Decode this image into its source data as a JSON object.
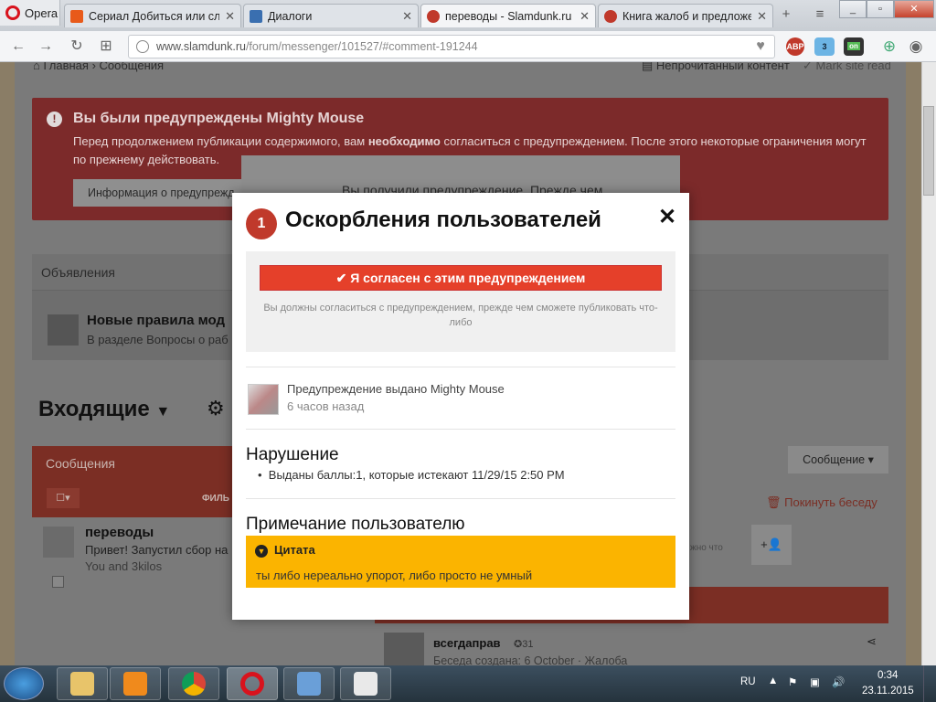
{
  "browser": {
    "opera_label": "Opera",
    "tabs": [
      {
        "title": "Сериал Добиться или сло",
        "active": false
      },
      {
        "title": "Диалоги",
        "active": false
      },
      {
        "title": "переводы - Slamdunk.ru -",
        "active": true
      },
      {
        "title": "Книга жалоб и предложе",
        "active": false
      }
    ],
    "url_host": "www.slamdunk.ru",
    "url_path": "/forum/messenger/101527/#comment-191244",
    "ext_abp": "ABP",
    "ext_ghost_count": "3",
    "ext_on": "on"
  },
  "page": {
    "breadcrumb_home": "Главная",
    "breadcrumb_current": "Сообщения",
    "unread_label": "Непрочитанный контент",
    "mark_read_label": "Mark site read",
    "alert_title": "Вы были предупреждены Mighty Mouse",
    "alert_text_1": "Перед продолжением публикации содержимого, вам ",
    "alert_text_bold": "необходимо",
    "alert_text_2": " согласиться с предупреждением. После этого некоторые ограничения могут",
    "alert_text_3": "по прежнему действовать.",
    "alert_button": "Информация о предупрежд",
    "announcements": "Объявления",
    "announce_title": "Новые правила мод",
    "announce_sub": "В разделе Вопросы о раб",
    "inbox_title": "Входящие",
    "messages_label": "Сообщения",
    "filter_label": "ФИЛЬ",
    "message_button": "Сообщение",
    "leave_conv": "Покинуть беседу",
    "conv_title": "переводы",
    "conv_preview": "Привет! Запустил сбор на",
    "conv_people": "You and 3kilos",
    "side_fragment": "жно что",
    "user_name": "всегдаправ",
    "user_rep": "31",
    "conv_created": "Беседа создана: 6 October · Жалоба",
    "back_card_text": "Вы получили предупреждение. Прежде чем"
  },
  "modal": {
    "badge": "1",
    "title": "Оскорбления пользователей",
    "close": "✕",
    "agree_button": "Я согласен с этим предупреждением",
    "agree_note": "Вы должны согласиться с предупреждением, прежде чем сможете публиковать что-либо",
    "issued_by": "Предупреждение выдано Mighty Mouse",
    "issued_ago": "6 часов назад",
    "violation_heading": "Нарушение",
    "violation_item": "Выданы баллы:1, которые истекают 11/29/15 2:50 PM",
    "note_heading": "Примечание пользователю",
    "quote_heading": "Цитата",
    "quote_text": "ты либо нереально упорот, либо просто не умный"
  },
  "taskbar": {
    "lang": "RU",
    "time": "0:34",
    "date": "23.11.2015"
  },
  "colors": {
    "accent_red": "#e5402a",
    "quote_yellow": "#fbb400",
    "badge_red": "#c0392b"
  }
}
